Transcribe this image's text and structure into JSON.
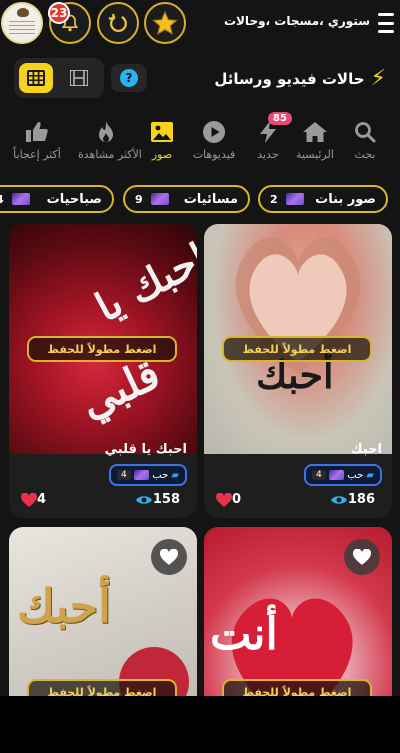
{
  "header": {
    "title": "ستوري ،مسجات ،وحالات",
    "notification_count": "23",
    "icons": [
      "menu-icon",
      "bell-icon",
      "refresh-icon",
      "star-icon"
    ]
  },
  "page": {
    "heading": "حالات فيديو ورسائل",
    "help_label": "?"
  },
  "nav": [
    {
      "label": "بحث",
      "icon": "search-icon",
      "active": false
    },
    {
      "label": "الرئيسية",
      "icon": "home-icon",
      "active": false
    },
    {
      "label": "جديد",
      "icon": "bolt-icon",
      "badge": "85",
      "active": false
    },
    {
      "label": "فيديوهات",
      "icon": "play-icon",
      "active": false
    },
    {
      "label": "صور",
      "icon": "image-icon",
      "active": true
    },
    {
      "label": "الأكثر مشاهدة",
      "icon": "flame-icon",
      "active": false
    },
    {
      "label": "أكثر إعجاباً",
      "icon": "thumbs-up-icon",
      "active": false
    }
  ],
  "chips": [
    {
      "label": "صور بنات",
      "count": "2"
    },
    {
      "label": "مسائيات",
      "count": "9"
    },
    {
      "label": "صباحيات",
      "count": "4"
    }
  ],
  "save_hint": "اضغط مطولاً للحفظ",
  "cards": [
    {
      "title": "احبك",
      "image_text": "أحبك",
      "tag": "حب",
      "tag_count": "4",
      "views": "186",
      "likes": "0"
    },
    {
      "title": "احبك يا قلبي",
      "image_text_1": "احبك يا",
      "image_text_2": "قلبي",
      "tag": "حب",
      "tag_count": "4",
      "views": "158",
      "likes": "4"
    },
    {
      "image_text": "أنت"
    },
    {
      "image_text": "أحبك"
    }
  ],
  "colors": {
    "accent": "#f6d21c",
    "heart": "#e8334a",
    "eye": "#2ab3ee",
    "tag_border": "#3b74e8"
  }
}
